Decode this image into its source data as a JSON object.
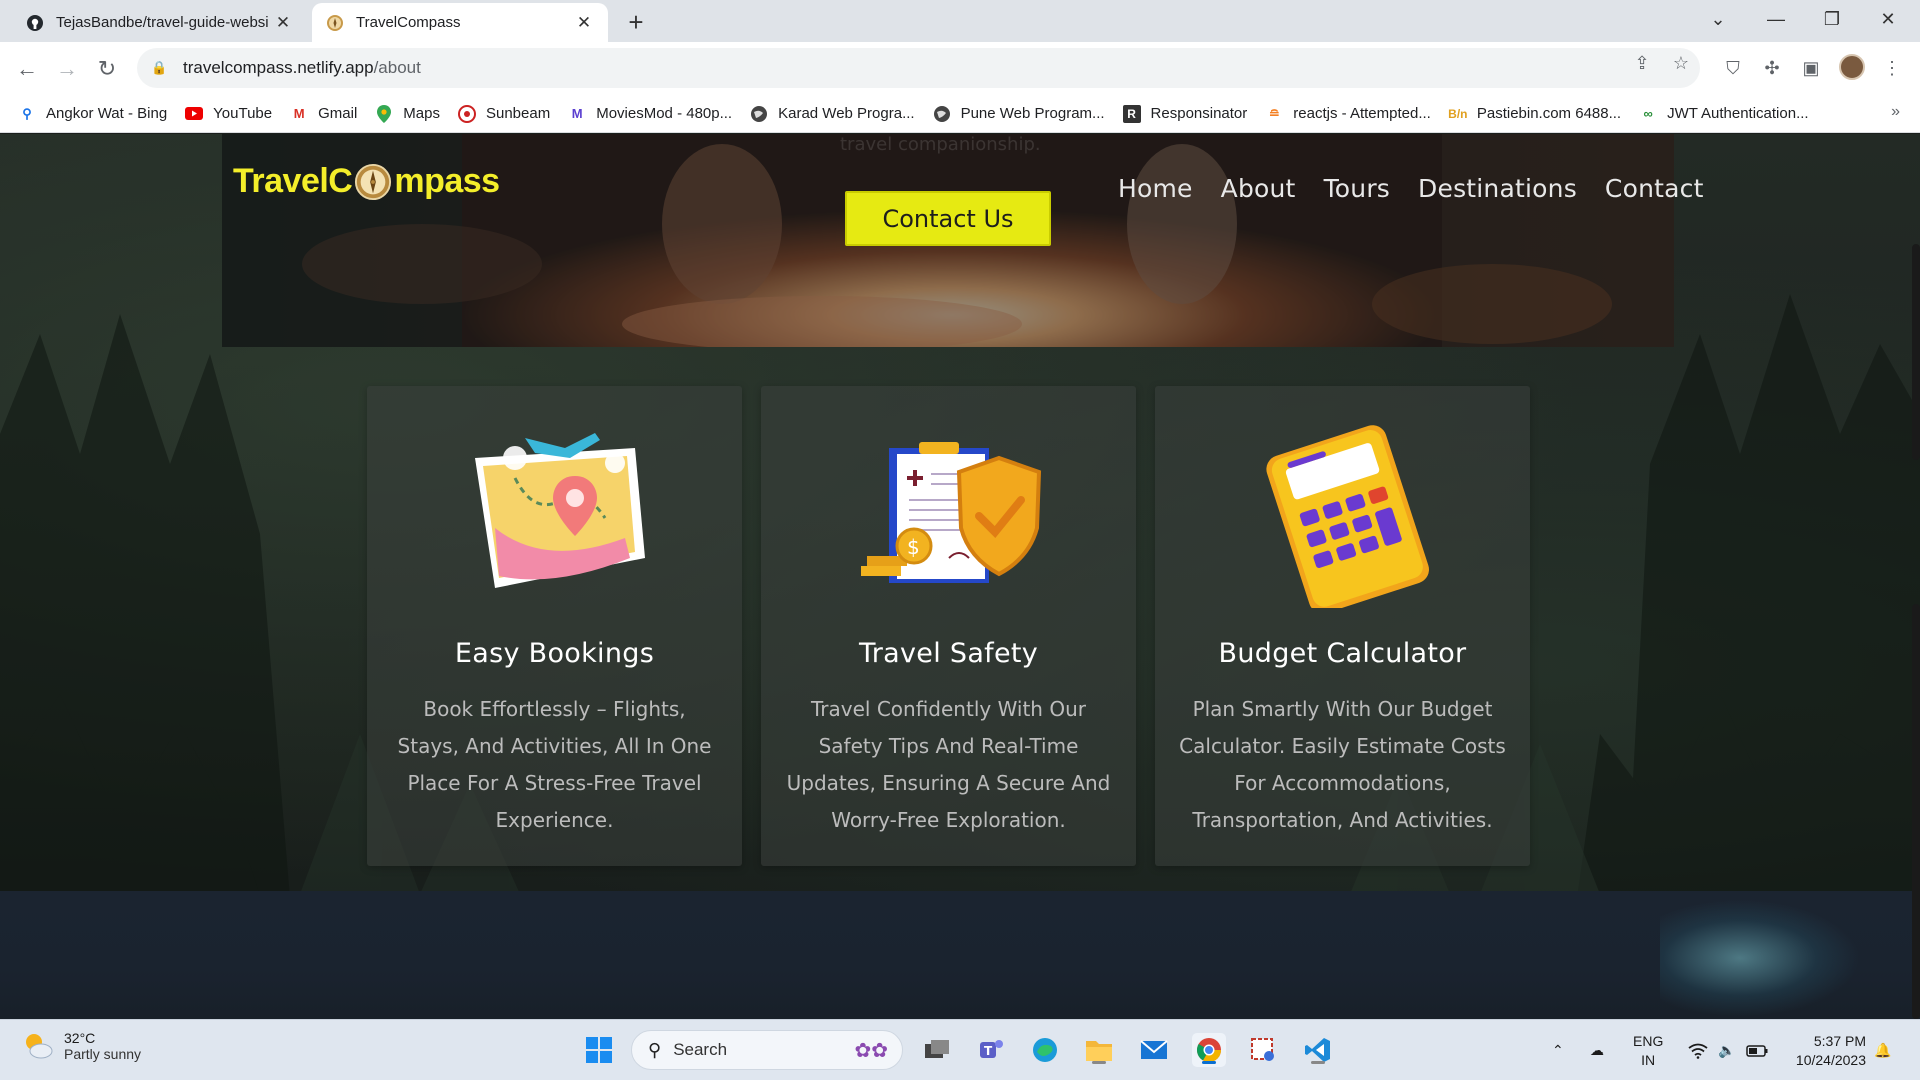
{
  "browser": {
    "tabs": [
      {
        "title": "TejasBandbe/travel-guide-websi",
        "icon": "github-icon",
        "active": false
      },
      {
        "title": "TravelCompass",
        "icon": "compass-favicon-icon",
        "active": true
      }
    ],
    "new_tab_label": "+",
    "url_host": "travelcompass.netlify.app",
    "url_path": "/about",
    "bookmarks": [
      {
        "label": "Angkor Wat - Bing",
        "icon": "bing-search-icon"
      },
      {
        "label": "YouTube",
        "icon": "youtube-icon"
      },
      {
        "label": "Gmail",
        "icon": "gmail-icon"
      },
      {
        "label": "Maps",
        "icon": "maps-icon"
      },
      {
        "label": "Sunbeam",
        "icon": "sunbeam-icon"
      },
      {
        "label": "MoviesMod - 480p...",
        "icon": "moviesmod-icon"
      },
      {
        "label": "Karad Web Progra...",
        "icon": "globe-icon"
      },
      {
        "label": "Pune Web Program...",
        "icon": "globe-icon"
      },
      {
        "label": "Responsinator",
        "icon": "responsinator-icon"
      },
      {
        "label": "reactjs - Attempted...",
        "icon": "stackoverflow-icon"
      },
      {
        "label": "Pastiebin.com 6488...",
        "icon": "pastebin-icon"
      },
      {
        "label": "JWT Authentication...",
        "icon": "jwt-icon"
      }
    ],
    "bookmarks_more": "»"
  },
  "site": {
    "logo_part1": "TravelC",
    "logo_part2": "mpass",
    "nav": [
      "Home",
      "About",
      "Tours",
      "Destinations",
      "Contact"
    ],
    "hero_ghost_text": "travel companionship.",
    "contact_button": "Contact Us",
    "cards": [
      {
        "icon": "travel-map-icon",
        "title": "Easy Bookings",
        "text": "Book Effortlessly – Flights, Stays, And Activities, All In One Place For A Stress-Free Travel Experience."
      },
      {
        "icon": "safety-shield-icon",
        "title": "Travel Safety",
        "text": "Travel Confidently With Our Safety Tips And Real-Time Updates, Ensuring A Secure And Worry-Free Exploration."
      },
      {
        "icon": "calculator-icon",
        "title": "Budget Calculator",
        "text": "Plan Smartly With Our Budget Calculator. Easily Estimate Costs For Accommodations, Transportation, And Activities."
      }
    ]
  },
  "taskbar": {
    "weather_temp": "32°C",
    "weather_desc": "Partly sunny",
    "search_label": "Search",
    "lang_top": "ENG",
    "lang_bottom": "IN",
    "time": "5:37 PM",
    "date": "10/24/2023"
  },
  "colors": {
    "brand_yellow": "#f4ee2a",
    "button_yellow": "#e6ea12",
    "card_bg": "#3a403c"
  }
}
